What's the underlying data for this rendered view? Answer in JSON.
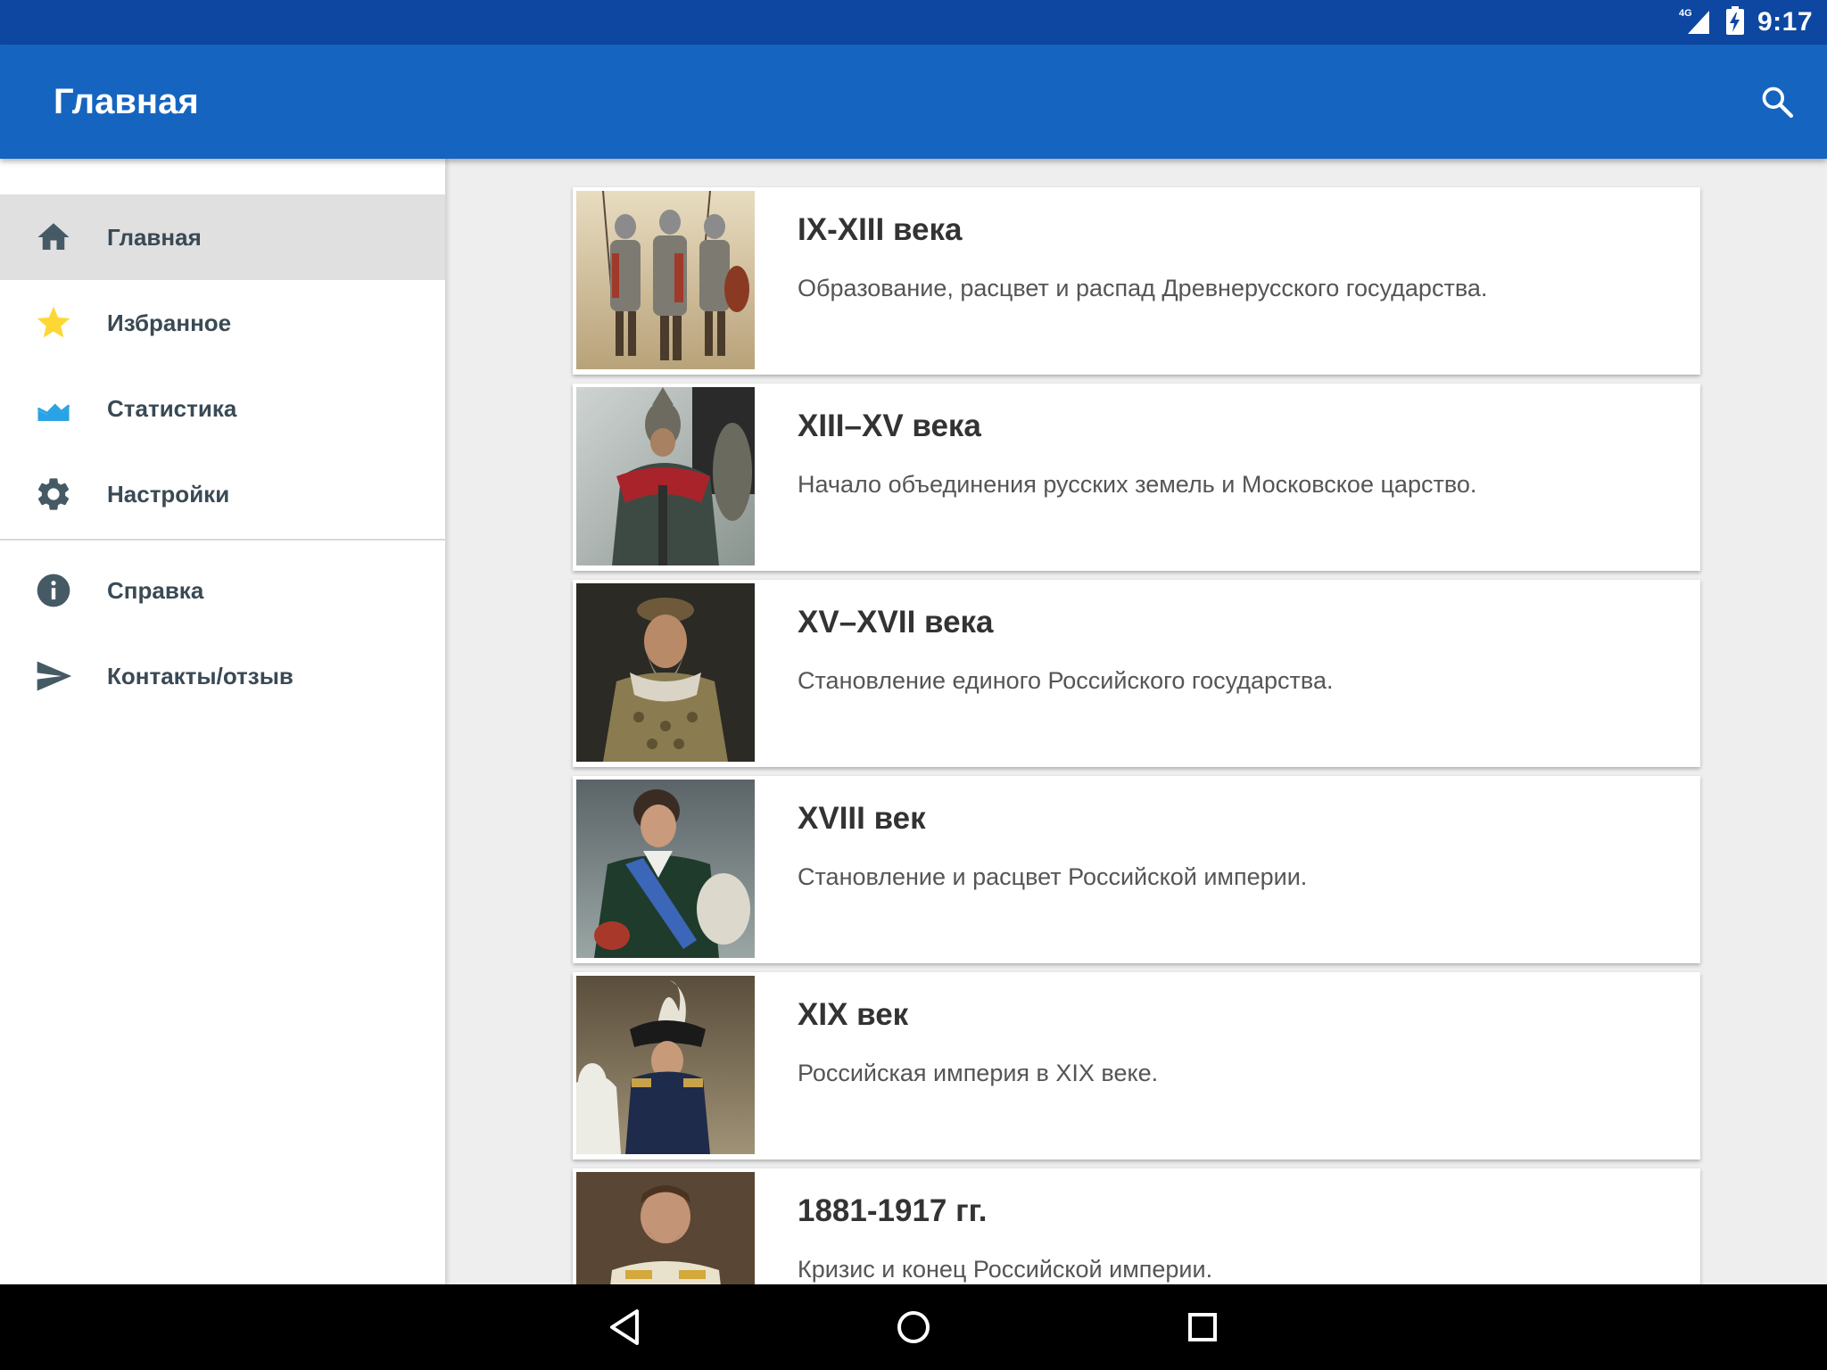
{
  "status_bar": {
    "network": "4G",
    "time": "9:17",
    "icons": [
      "signal-4g-icon",
      "battery-charging-icon"
    ]
  },
  "app_bar": {
    "title": "Главная",
    "search_icon": "search-icon"
  },
  "drawer": {
    "items": [
      {
        "label": "Главная",
        "icon": "home-icon",
        "active": true
      },
      {
        "label": "Избранное",
        "icon": "star-icon"
      },
      {
        "label": "Статистика",
        "icon": "chart-icon"
      },
      {
        "label": "Настройки",
        "icon": "gear-icon"
      },
      {
        "label": "Справка",
        "icon": "info-icon"
      },
      {
        "label": "Контакты/отзыв",
        "icon": "send-icon"
      }
    ]
  },
  "periods": [
    {
      "title": "IX-XIII века",
      "description": "Образование, расцвет и распад Древнерусского государства."
    },
    {
      "title": "XIII–XV века",
      "description": "Начало объединения русских земель и Московское царство."
    },
    {
      "title": "XV–XVII века",
      "description": "Становление единого Российского государства."
    },
    {
      "title": "XVIII век",
      "description": "Становление и расцвет Российской империи."
    },
    {
      "title": "XIX век",
      "description": "Российская империя в XIX веке."
    },
    {
      "title": "1881-1917 гг.",
      "description": "Кризис и конец Российской империи."
    }
  ],
  "colors": {
    "status_bar": "#0d47a1",
    "app_bar": "#1565c0",
    "star": "#fdd835",
    "chart": "#29a3e6",
    "drawer_icon": "#455a64"
  }
}
